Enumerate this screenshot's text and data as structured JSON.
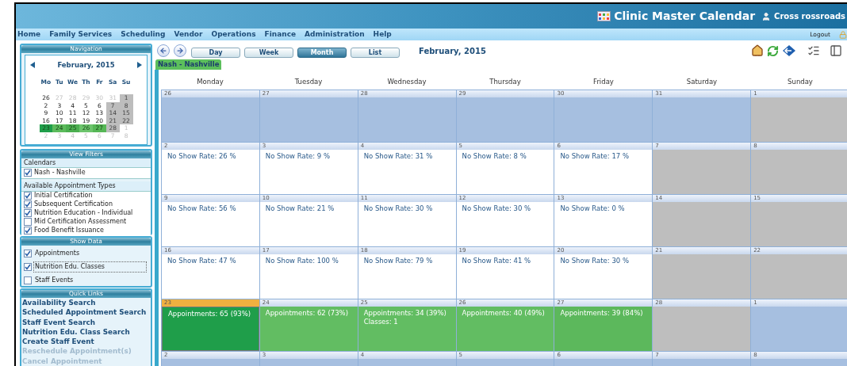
{
  "header": {
    "title": "Clinic Master Calendar",
    "user": "Cross rossroads"
  },
  "menu": {
    "items": [
      "Home",
      "Family Services",
      "Scheduling",
      "Vendor",
      "Operations",
      "Finance",
      "Administration",
      "Help"
    ],
    "logout": "Logout"
  },
  "navigation": {
    "title": "Navigation",
    "month": "February, 2015",
    "weekdays": [
      "Mo",
      "Tu",
      "We",
      "Th",
      "Fr",
      "Sa",
      "Su"
    ],
    "weeks": [
      [
        {
          "d": "26",
          "kind": "normal"
        },
        {
          "d": "27",
          "kind": "faded"
        },
        {
          "d": "28",
          "kind": "faded"
        },
        {
          "d": "29",
          "kind": "faded"
        },
        {
          "d": "30",
          "kind": "faded"
        },
        {
          "d": "31",
          "kind": "faded"
        },
        {
          "d": "1",
          "kind": "weekend"
        }
      ],
      [
        {
          "d": "2",
          "kind": "normal"
        },
        {
          "d": "3",
          "kind": "normal"
        },
        {
          "d": "4",
          "kind": "normal"
        },
        {
          "d": "5",
          "kind": "normal"
        },
        {
          "d": "6",
          "kind": "normal"
        },
        {
          "d": "7",
          "kind": "weekend"
        },
        {
          "d": "8",
          "kind": "weekend"
        }
      ],
      [
        {
          "d": "9",
          "kind": "normal"
        },
        {
          "d": "10",
          "kind": "normal"
        },
        {
          "d": "11",
          "kind": "normal"
        },
        {
          "d": "12",
          "kind": "normal"
        },
        {
          "d": "13",
          "kind": "normal"
        },
        {
          "d": "14",
          "kind": "weekend"
        },
        {
          "d": "15",
          "kind": "weekend"
        }
      ],
      [
        {
          "d": "16",
          "kind": "normal"
        },
        {
          "d": "17",
          "kind": "normal"
        },
        {
          "d": "18",
          "kind": "normal"
        },
        {
          "d": "19",
          "kind": "normal"
        },
        {
          "d": "20",
          "kind": "normal"
        },
        {
          "d": "21",
          "kind": "weekend"
        },
        {
          "d": "22",
          "kind": "weekend"
        }
      ],
      [
        {
          "d": "23",
          "kind": "heat",
          "color": "#1f9e4a"
        },
        {
          "d": "24",
          "kind": "heat",
          "color": "#5cbb5c"
        },
        {
          "d": "25",
          "kind": "heat",
          "color": "#4caf50"
        },
        {
          "d": "26",
          "kind": "heat",
          "color": "#6cc46c"
        },
        {
          "d": "27",
          "kind": "heat",
          "color": "#56b756"
        },
        {
          "d": "28",
          "kind": "weekend"
        },
        {
          "d": "1",
          "kind": "faded"
        }
      ],
      [
        {
          "d": "2",
          "kind": "faded"
        },
        {
          "d": "3",
          "kind": "faded"
        },
        {
          "d": "4",
          "kind": "faded"
        },
        {
          "d": "5",
          "kind": "faded"
        },
        {
          "d": "6",
          "kind": "faded"
        },
        {
          "d": "7",
          "kind": "faded"
        },
        {
          "d": "8",
          "kind": "faded"
        }
      ]
    ]
  },
  "view_filters": {
    "title": "View Filters",
    "calendars_heading": "Calendars",
    "calendars": [
      {
        "label": "Nash - Nashville",
        "checked": true
      }
    ],
    "types_heading": "Available Appointment Types",
    "types": [
      {
        "label": "Initial Certification",
        "checked": true
      },
      {
        "label": "Subsequent Certification",
        "checked": true
      },
      {
        "label": "Nutrition Education - Individual",
        "checked": true
      },
      {
        "label": "Mid Certification Assessment",
        "checked": false
      },
      {
        "label": "Food Benefit Issuance",
        "checked": true
      }
    ]
  },
  "show_data": {
    "title": "Show Data",
    "items": [
      {
        "label": "Appointments",
        "checked": true,
        "focused": false
      },
      {
        "label": "Nutrition Edu. Classes",
        "checked": true,
        "focused": true
      },
      {
        "label": "Staff Events",
        "checked": false,
        "focused": false
      }
    ]
  },
  "quick_links": {
    "title": "Quick Links",
    "items": [
      {
        "label": "Availability Search",
        "disabled": false
      },
      {
        "label": "Scheduled Appointment Search",
        "disabled": false
      },
      {
        "label": "Staff Event Search",
        "disabled": false
      },
      {
        "label": "Nutrition Edu. Class Search",
        "disabled": false
      },
      {
        "label": "Create Staff Event",
        "disabled": false
      },
      {
        "label": "Reschedule Appointment(s)",
        "disabled": true
      },
      {
        "label": "Cancel Appointment",
        "disabled": true
      }
    ]
  },
  "toolbar": {
    "views": [
      {
        "label": "Day",
        "selected": false
      },
      {
        "label": "Week",
        "selected": false
      },
      {
        "label": "Month",
        "selected": true
      },
      {
        "label": "List",
        "selected": false
      }
    ],
    "title": "February, 2015"
  },
  "tab": {
    "label": "Nash - Nashville"
  },
  "calendar": {
    "weekdays": [
      "Monday",
      "Tuesday",
      "Wednesday",
      "Thursday",
      "Friday",
      "Saturday",
      "Sunday"
    ],
    "weeks": [
      [
        {
          "date": "26",
          "kind": "other",
          "today": false
        },
        {
          "date": "27",
          "kind": "other",
          "today": false
        },
        {
          "date": "28",
          "kind": "other",
          "today": false
        },
        {
          "date": "29",
          "kind": "other",
          "today": false
        },
        {
          "date": "30",
          "kind": "other",
          "today": false
        },
        {
          "date": "31",
          "kind": "other",
          "today": false
        },
        {
          "date": "1",
          "kind": "weekend",
          "today": false
        }
      ],
      [
        {
          "date": "2",
          "kind": "weekday",
          "today": false,
          "lines": [
            "No Show Rate: 26 %"
          ]
        },
        {
          "date": "3",
          "kind": "weekday",
          "today": false,
          "lines": [
            "No Show Rate: 9 %"
          ]
        },
        {
          "date": "4",
          "kind": "weekday",
          "today": false,
          "lines": [
            "No Show Rate: 31 %"
          ]
        },
        {
          "date": "5",
          "kind": "weekday",
          "today": false,
          "lines": [
            "No Show Rate: 8 %"
          ]
        },
        {
          "date": "6",
          "kind": "weekday",
          "today": false,
          "lines": [
            "No Show Rate: 17 %"
          ]
        },
        {
          "date": "7",
          "kind": "weekend",
          "today": false
        },
        {
          "date": "8",
          "kind": "weekend",
          "today": false
        }
      ],
      [
        {
          "date": "9",
          "kind": "weekday",
          "today": false,
          "lines": [
            "No Show Rate: 56 %"
          ]
        },
        {
          "date": "10",
          "kind": "weekday",
          "today": false,
          "lines": [
            "No Show Rate: 21 %"
          ]
        },
        {
          "date": "11",
          "kind": "weekday",
          "today": false,
          "lines": [
            "No Show Rate: 30 %"
          ]
        },
        {
          "date": "12",
          "kind": "weekday",
          "today": false,
          "lines": [
            "No Show Rate: 30 %"
          ]
        },
        {
          "date": "13",
          "kind": "weekday",
          "today": false,
          "lines": [
            "No Show Rate: 0 %"
          ]
        },
        {
          "date": "14",
          "kind": "weekend",
          "today": false
        },
        {
          "date": "15",
          "kind": "weekend",
          "today": false
        }
      ],
      [
        {
          "date": "16",
          "kind": "weekday",
          "today": false,
          "lines": [
            "No Show Rate: 47 %"
          ]
        },
        {
          "date": "17",
          "kind": "weekday",
          "today": false,
          "lines": [
            "No Show Rate: 100 %"
          ]
        },
        {
          "date": "18",
          "kind": "weekday",
          "today": false,
          "lines": [
            "No Show Rate: 79 %"
          ]
        },
        {
          "date": "19",
          "kind": "weekday",
          "today": false,
          "lines": [
            "No Show Rate: 41 %"
          ]
        },
        {
          "date": "20",
          "kind": "weekday",
          "today": false,
          "lines": [
            "No Show Rate: 30 %"
          ]
        },
        {
          "date": "21",
          "kind": "weekend",
          "today": false
        },
        {
          "date": "22",
          "kind": "weekend",
          "today": false
        }
      ],
      [
        {
          "date": "23",
          "kind": "heat",
          "color": "#1f9e4a",
          "today": true,
          "lines": [
            "Appointments: 65 (93%)"
          ]
        },
        {
          "date": "24",
          "kind": "heat",
          "color": "#62bd62",
          "today": false,
          "lines": [
            "Appointments: 62 (73%)"
          ]
        },
        {
          "date": "25",
          "kind": "heat",
          "color": "#62bd62",
          "today": false,
          "lines": [
            "Appointments: 34 (39%)",
            "Classes: 1"
          ]
        },
        {
          "date": "26",
          "kind": "heat",
          "color": "#62bd62",
          "today": false,
          "lines": [
            "Appointments: 40 (49%)"
          ]
        },
        {
          "date": "27",
          "kind": "heat",
          "color": "#5cb85c",
          "today": false,
          "lines": [
            "Appointments: 39 (84%)"
          ]
        },
        {
          "date": "28",
          "kind": "weekend",
          "today": false
        },
        {
          "date": "1",
          "kind": "other",
          "today": false
        }
      ],
      [
        {
          "date": "2",
          "kind": "other",
          "today": false
        },
        {
          "date": "3",
          "kind": "other",
          "today": false
        },
        {
          "date": "4",
          "kind": "other",
          "today": false
        },
        {
          "date": "5",
          "kind": "other",
          "today": false
        },
        {
          "date": "6",
          "kind": "other",
          "today": false
        },
        {
          "date": "7",
          "kind": "other",
          "today": false
        },
        {
          "date": "8",
          "kind": "other",
          "today": false
        }
      ]
    ]
  }
}
